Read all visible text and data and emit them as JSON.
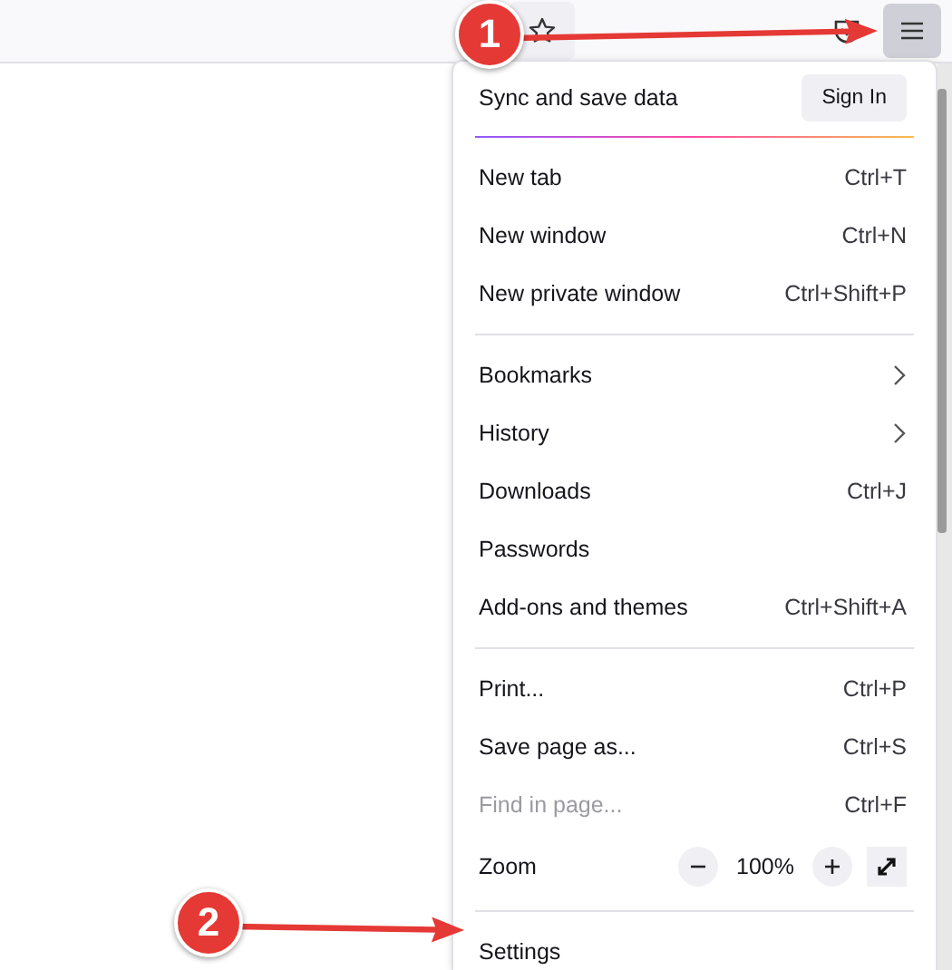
{
  "toolbar": {
    "menu_button_selected": true
  },
  "menu": {
    "header": {
      "title": "Sync and save data",
      "button": "Sign In"
    },
    "sections": [
      [
        {
          "kind": "item",
          "label": "New tab",
          "shortcut": "Ctrl+T"
        },
        {
          "kind": "item",
          "label": "New window",
          "shortcut": "Ctrl+N"
        },
        {
          "kind": "item",
          "label": "New private window",
          "shortcut": "Ctrl+Shift+P"
        }
      ],
      [
        {
          "kind": "submenu",
          "label": "Bookmarks"
        },
        {
          "kind": "submenu",
          "label": "History"
        },
        {
          "kind": "item",
          "label": "Downloads",
          "shortcut": "Ctrl+J"
        },
        {
          "kind": "item",
          "label": "Passwords"
        },
        {
          "kind": "item",
          "label": "Add-ons and themes",
          "shortcut": "Ctrl+Shift+A"
        }
      ],
      [
        {
          "kind": "item",
          "label": "Print...",
          "shortcut": "Ctrl+P"
        },
        {
          "kind": "item",
          "label": "Save page as...",
          "shortcut": "Ctrl+S"
        },
        {
          "kind": "item",
          "label": "Find in page...",
          "shortcut": "Ctrl+F",
          "disabled": true
        },
        {
          "kind": "zoom",
          "label": "Zoom",
          "value": "100%"
        }
      ],
      [
        {
          "kind": "item",
          "label": "Settings"
        }
      ]
    ]
  },
  "annotations": [
    {
      "label": "1"
    },
    {
      "label": "2"
    }
  ]
}
